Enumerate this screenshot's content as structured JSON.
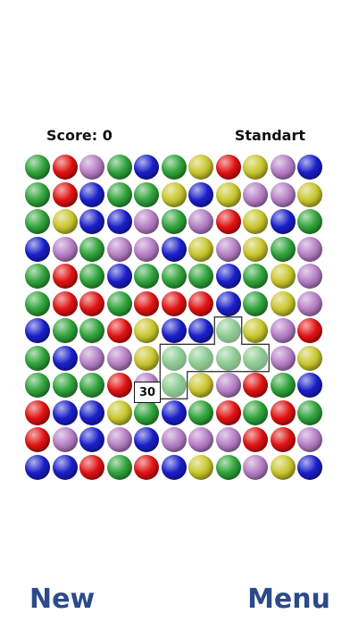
{
  "header": {
    "score_text": "Score: 0",
    "mode_text": "Standart"
  },
  "colors": {
    "G": "#2fa33a",
    "R": "#e01212",
    "P": "#b67fc6",
    "B": "#1a1fc9",
    "Y": "#c9c72e"
  },
  "board": {
    "rows": [
      "GRPGBGYRYPB",
      "GRBGGYBYPPY",
      "GYBBPGPRYBG",
      "BPGPPBYPYGP",
      "GRGBGGGBGYP",
      "GRRGRRRBGYP",
      "BGGRYBBGYPR",
      "GBPPYGGGGPY",
      "GGGRPGYPRGB",
      "RBBYGBGRGRG",
      "RPBPBPPPRRP",
      "BBRGRBYGPYB"
    ],
    "selected": [
      [
        6,
        7
      ],
      [
        7,
        5
      ],
      [
        7,
        6
      ],
      [
        7,
        7
      ],
      [
        7,
        8
      ],
      [
        8,
        5
      ]
    ]
  },
  "popup": {
    "points": "30"
  },
  "footer": {
    "new_label": "New",
    "menu_label": "Menu"
  }
}
